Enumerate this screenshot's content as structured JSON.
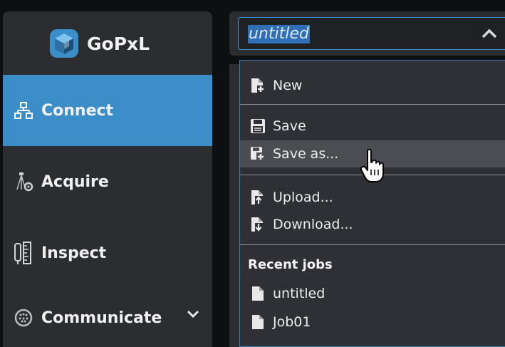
{
  "app": {
    "logo_text": "GoPxL"
  },
  "sidebar": {
    "items": [
      {
        "label": "Connect",
        "icon": "network-icon",
        "active": true
      },
      {
        "label": "Acquire",
        "icon": "sensor-icon",
        "active": false
      },
      {
        "label": "Inspect",
        "icon": "ruler-icon",
        "active": false
      },
      {
        "label": "Communicate",
        "icon": "connector-icon",
        "active": false,
        "expandable": true
      }
    ]
  },
  "job_selector": {
    "value": "untitled",
    "open": true
  },
  "menu": {
    "new_label": "New",
    "save_label": "Save",
    "save_as_label": "Save as...",
    "upload_label": "Upload...",
    "download_label": "Download...",
    "hovered_item": "Save as...",
    "recent_heading": "Recent jobs",
    "recent_jobs": [
      "untitled",
      "Job01"
    ]
  },
  "colors": {
    "accent": "#3b8ec7",
    "sidebar_bg": "#2b2d31",
    "menu_bg": "#2e3035",
    "selection": "#2f6fb5"
  }
}
